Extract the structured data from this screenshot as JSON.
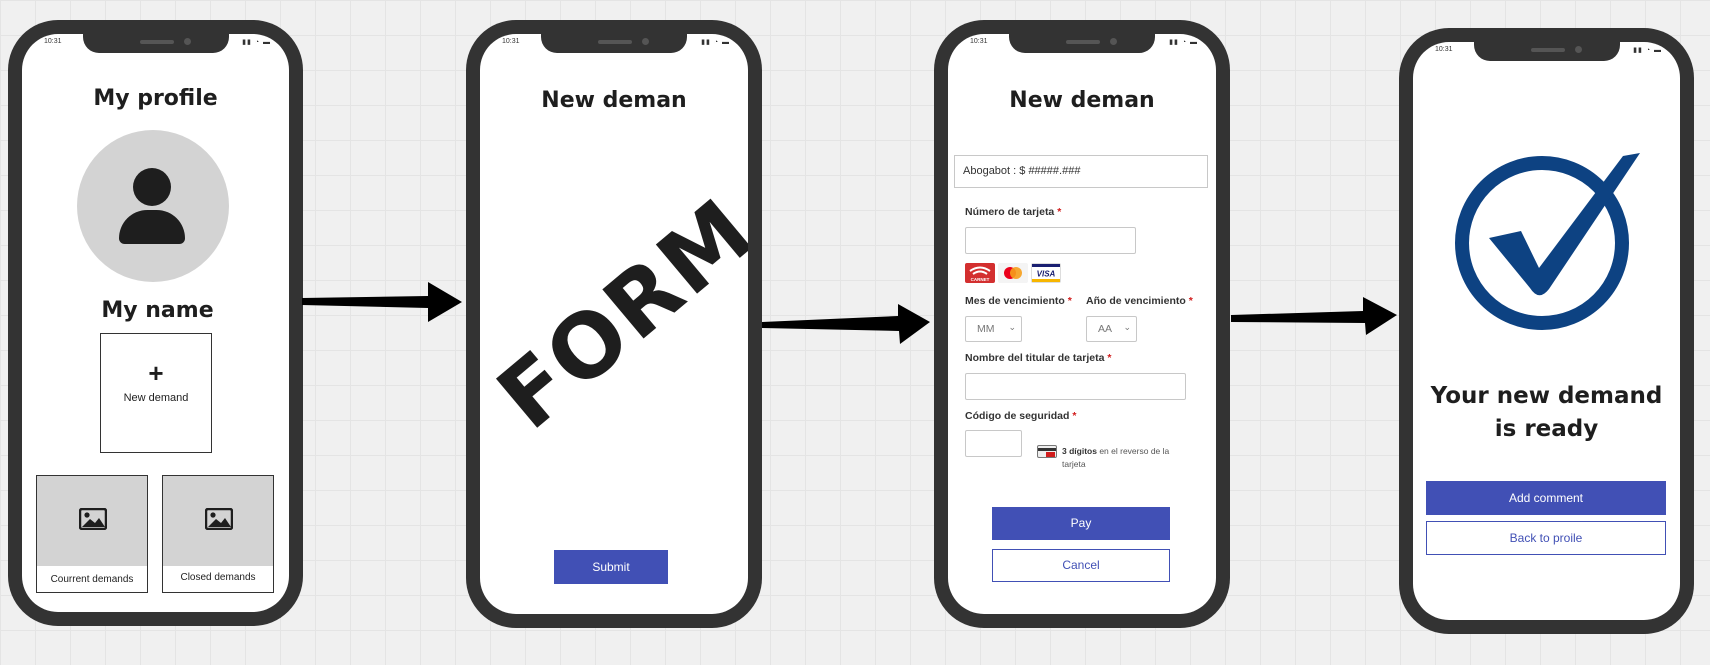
{
  "status_bar": {
    "time": "10:31",
    "icons": "▮▮ ◔ ▬"
  },
  "screen1": {
    "title": "My profile",
    "user_name": "My name",
    "new_demand": {
      "icon": "plus-icon",
      "label": "New demand"
    },
    "current_demands_label": "Courrent demands",
    "closed_demands_label": "Closed demands"
  },
  "screen2": {
    "title": "New deman",
    "form_placeholder": "FORM",
    "submit_label": "Submit"
  },
  "screen3": {
    "title": "New deman",
    "price_line": "Abogabot : $ #####.###",
    "card_number_label": "Número de tarjeta",
    "card_logos": [
      "CARNET",
      "mastercard",
      "VISA"
    ],
    "expiry_month_label": "Mes de vencimiento",
    "expiry_month_value": "MM",
    "expiry_year_label": "Año de vencimiento",
    "expiry_year_value": "AA",
    "cardholder_label": "Nombre del titular de tarjeta",
    "security_code_label": "Código de seguridad",
    "security_hint_bold": "3 dígitos",
    "security_hint_rest": "en el reverso de la",
    "security_hint_line2": "tarjeta",
    "required_mark": "*",
    "pay_label": "Pay",
    "cancel_label": "Cancel"
  },
  "screen4": {
    "ready_line1": "Your new demand",
    "ready_line2": "is ready",
    "add_comment_label": "Add comment",
    "back_label": "Back to proile"
  },
  "colors": {
    "accent": "#4150b5",
    "check": "#0d4282",
    "phone_frame": "#333333",
    "placeholder_gray": "#d3d3d3"
  }
}
